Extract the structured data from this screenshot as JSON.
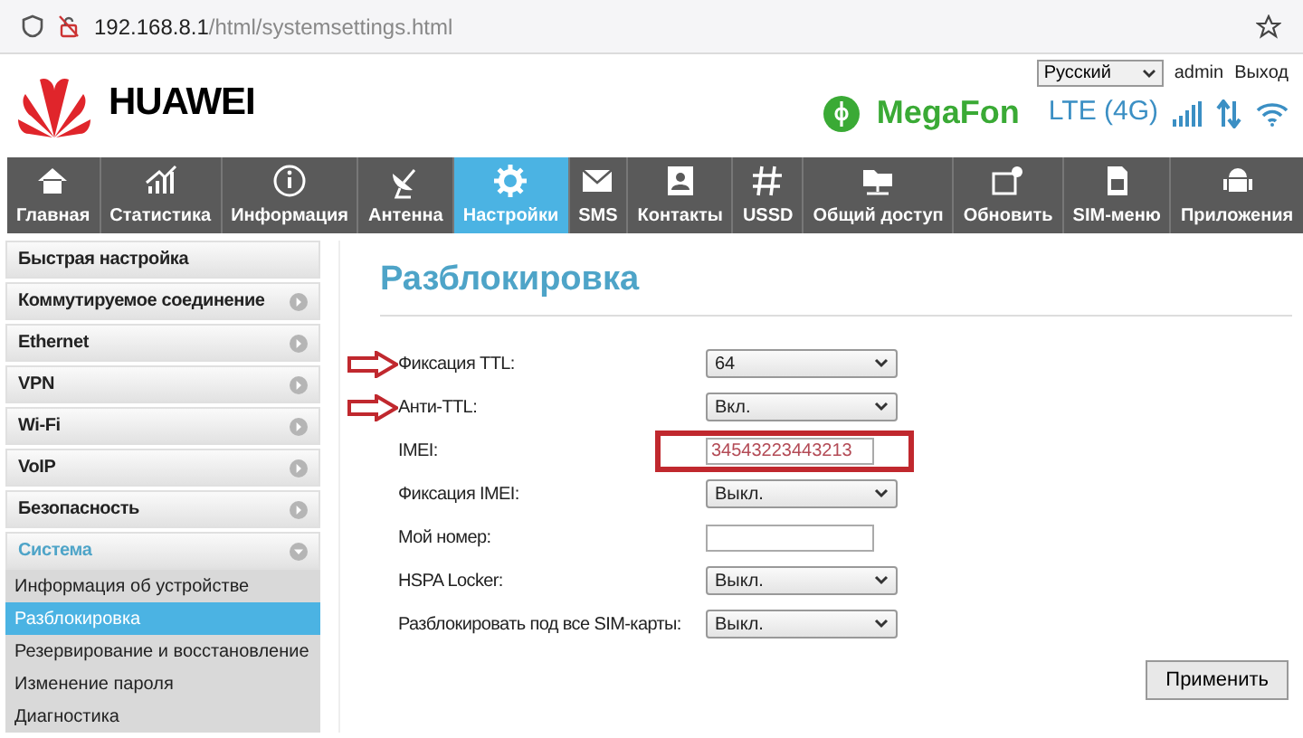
{
  "browser": {
    "url_host": "192.168.8.1",
    "url_path": "/html/systemsettings.html"
  },
  "header": {
    "brand": "HUAWEI",
    "operator": "MegaFon",
    "network": "LTE (4G)",
    "language": "Русский",
    "user": "admin",
    "logout": "Выход"
  },
  "nav": [
    {
      "label": "Главная",
      "selected": false
    },
    {
      "label": "Статистика",
      "selected": false
    },
    {
      "label": "Информация",
      "selected": false
    },
    {
      "label": "Антенна",
      "selected": false
    },
    {
      "label": "Настройки",
      "selected": true
    },
    {
      "label": "SMS",
      "selected": false
    },
    {
      "label": "Контакты",
      "selected": false
    },
    {
      "label": "USSD",
      "selected": false
    },
    {
      "label": "Общий доступ",
      "selected": false
    },
    {
      "label": "Обновить",
      "selected": false
    },
    {
      "label": "SIM-меню",
      "selected": false
    },
    {
      "label": "Приложения",
      "selected": false
    }
  ],
  "sidebar": [
    {
      "label": "Быстрая настройка"
    },
    {
      "label": "Коммутируемое соединение",
      "expanded": false
    },
    {
      "label": "Ethernet",
      "expanded": false
    },
    {
      "label": "VPN",
      "expanded": false
    },
    {
      "label": "Wi-Fi",
      "expanded": false
    },
    {
      "label": "VoIP",
      "expanded": false
    },
    {
      "label": "Безопасность",
      "expanded": false
    },
    {
      "label": "Система",
      "expanded": true,
      "children": [
        {
          "label": "Информация об устройстве",
          "selected": false
        },
        {
          "label": "Разблокировка",
          "selected": true
        },
        {
          "label": "Резервирование и восстановление",
          "selected": false
        },
        {
          "label": "Изменение пароля",
          "selected": false
        },
        {
          "label": "Диагностика",
          "selected": false
        }
      ]
    }
  ],
  "page": {
    "title": "Разблокировка",
    "fields": [
      {
        "kind": "select",
        "label": "Фиксация TTL:",
        "value": "64",
        "arrow_marker": true
      },
      {
        "kind": "select",
        "label": "Анти-TTL:",
        "value": "Вкл.",
        "arrow_marker": true
      },
      {
        "kind": "input",
        "label": "IMEI:",
        "value": "34543223443213",
        "boxed": true
      },
      {
        "kind": "select",
        "label": "Фиксация IMEI:",
        "value": "Выкл."
      },
      {
        "kind": "input",
        "label": "Мой номер:"
      },
      {
        "kind": "select",
        "label": "HSPA Locker:",
        "value": "Выкл."
      },
      {
        "kind": "select",
        "label": "Разблокировать под все SIM-карты:",
        "value": "Выкл."
      }
    ],
    "apply_button": "Применить"
  }
}
